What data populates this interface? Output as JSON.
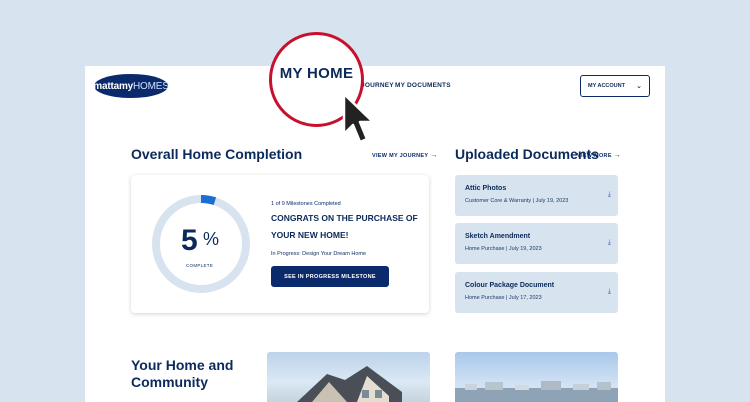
{
  "header": {
    "logo_bold": "mattamy",
    "logo_light": "HOMES",
    "nav_journey": "JOURNEY",
    "nav_docs": "MY DOCUMENTS",
    "account": "MY ACCOUNT"
  },
  "spotlight": {
    "label": "MY HOME"
  },
  "completion": {
    "title": "Overall Home Completion",
    "link": "VIEW MY JOURNEY",
    "percent": "5",
    "percent_sign": "%",
    "percent_value": 5,
    "complete_label": "COMPLETE",
    "milestones": "1 of 9 Milestones Completed",
    "congrats": "CONGRATS ON THE PURCHASE OF YOUR NEW HOME!",
    "in_progress": "In Progress: Design Your Dream Home",
    "button": "SEE IN PROGRESS MILESTONE"
  },
  "documents": {
    "title": "Uploaded Documents",
    "link": "VIEW MORE",
    "items": [
      {
        "title": "Attic Photos",
        "meta": "Customer Core & Warranty | July 19, 2023"
      },
      {
        "title": "Sketch Amendment",
        "meta": "Home Purchase | July 19, 2023"
      },
      {
        "title": "Colour Package Document",
        "meta": "Home Purchase | July 17, 2023"
      }
    ]
  },
  "community": {
    "title_line1": "Your Home and",
    "title_line2": "Community"
  },
  "colors": {
    "primary": "#0b2a6b",
    "accent": "#c8102e",
    "bg": "#d7e3ee",
    "progress": "#1b6fd1"
  },
  "icons": {
    "cursor": "pointer-cursor-icon",
    "download": "download-icon",
    "arrow": "arrow-right-icon",
    "chevron": "chevron-down-icon"
  }
}
